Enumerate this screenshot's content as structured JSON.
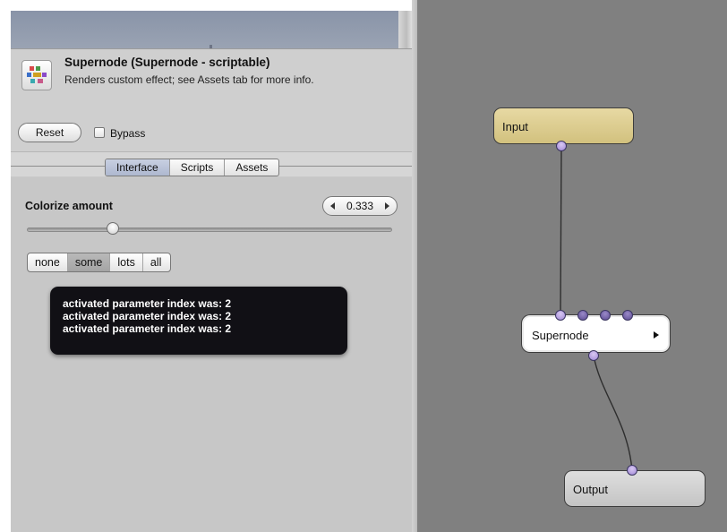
{
  "inspector": {
    "title": "Supernode (Supernode - scriptable)",
    "description": "Renders custom effect; see Assets tab for more info.",
    "icon": "supernode-icon",
    "reset_label": "Reset",
    "bypass_label": "Bypass",
    "bypass_checked": false
  },
  "tabs": [
    {
      "label": "Interface",
      "active": true
    },
    {
      "label": "Scripts",
      "active": false
    },
    {
      "label": "Assets",
      "active": false
    }
  ],
  "parameter": {
    "label": "Colorize amount",
    "value_text": "0.333",
    "value": 0.333,
    "min": 0,
    "max": 1
  },
  "choices": [
    {
      "label": "none",
      "selected": false
    },
    {
      "label": "some",
      "selected": true
    },
    {
      "label": "lots",
      "selected": false
    },
    {
      "label": "all",
      "selected": false
    }
  ],
  "console": {
    "lines": [
      "activated parameter index was: 2",
      "activated parameter index was: 2",
      "activated parameter index was: 2"
    ]
  },
  "graph": {
    "nodes": {
      "input": {
        "label": "Input",
        "color": "#ddcd8f"
      },
      "supernode": {
        "label": "Supernode",
        "color": "#ffffff"
      },
      "output": {
        "label": "Output",
        "color": "#d1d1d1"
      }
    },
    "canvas_color": "#808080",
    "port_color": "#a58ddb"
  }
}
